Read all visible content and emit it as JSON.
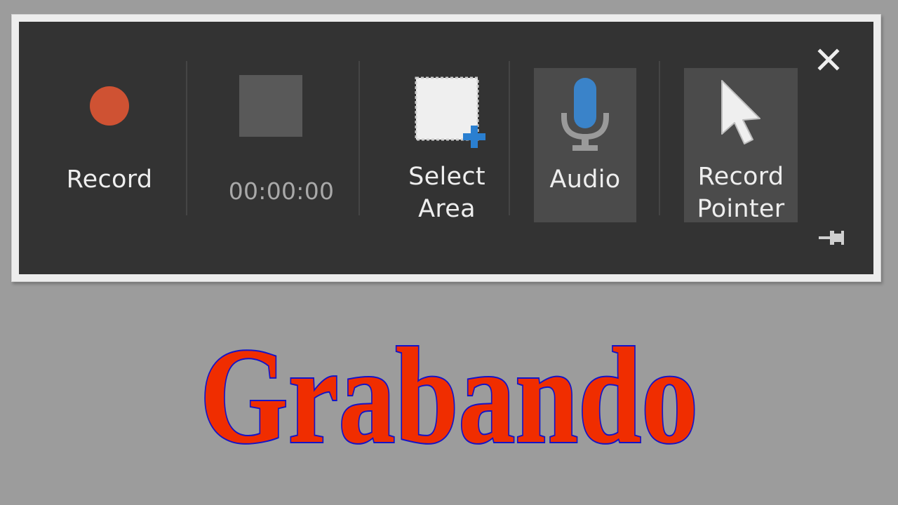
{
  "toolbar": {
    "record_label": "Record",
    "timer": "00:00:00",
    "select_area_label": "Select\nArea",
    "audio_label": "Audio",
    "record_pointer_label": "Record\nPointer",
    "close_icon": "close-icon",
    "pin_icon": "pin-icon"
  },
  "colors": {
    "record": "#cf5233",
    "mic": "#3a83c9",
    "plus": "#2a7fd0",
    "caption_fill": "#f02d00",
    "caption_stroke": "#1414c8"
  },
  "caption": {
    "text": "Grabando"
  }
}
